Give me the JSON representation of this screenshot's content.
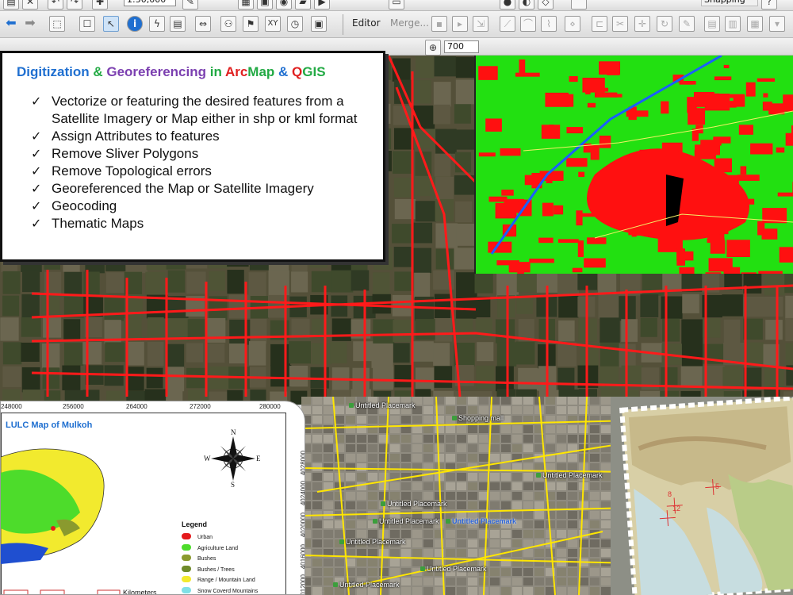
{
  "toolbar": {
    "scale_value": "1:50,000",
    "snapping_label": "Snapping",
    "editor_label": "Editor",
    "merge_label": "Merge...",
    "xy_label": "XY",
    "zoom_value": "700"
  },
  "info_box": {
    "title_parts": [
      {
        "text": "Digitization",
        "color": "#1f6fd0"
      },
      {
        "text": " & ",
        "color": "#22aa44"
      },
      {
        "text": "Georeferencing",
        "color": "#7b3fb0"
      },
      {
        "text": " in ",
        "color": "#22aa44"
      },
      {
        "text": "Arc",
        "color": "#e02020"
      },
      {
        "text": "Map",
        "color": "#22aa44"
      },
      {
        "text": " & ",
        "color": "#1f6fd0"
      },
      {
        "text": "Q",
        "color": "#e02020"
      },
      {
        "text": "GIS",
        "color": "#22aa44"
      }
    ],
    "items": [
      "Vectorize or featuring the desired features from a Satellite Imagery or Map either in shp or kml format",
      "Assign Attributes to features",
      "Remove Sliver Polygons",
      "Remove Topological errors",
      "Georeferenced the Map or Satellite Imagery",
      "Geocoding",
      "Thematic Maps"
    ]
  },
  "lulc_map": {
    "title": "LULC Map of Mulkoh",
    "x_ticks": [
      "248000",
      "256000",
      "264000",
      "272000",
      "280000"
    ],
    "y_ticks": [
      "4028000",
      "4024000",
      "4020000",
      "4016000",
      "4012000"
    ],
    "compass": {
      "n": "N",
      "s": "S",
      "e": "E",
      "w": "W"
    },
    "legend_title": "Legend",
    "legend": [
      {
        "label": "Urban",
        "color": "#e41a1c"
      },
      {
        "label": "Agriculture Land",
        "color": "#4ddc2b"
      },
      {
        "label": "Bushes",
        "color": "#8a9a2e"
      },
      {
        "label": "Bushes / Trees",
        "color": "#6f8b2a"
      },
      {
        "label": "Range / Mountain Land",
        "color": "#f2ea2e"
      },
      {
        "label": "Snow Coverd Mountains",
        "color": "#7fe0e6"
      }
    ],
    "scale_label": "Kilometers"
  },
  "city_map": {
    "placemarks": [
      {
        "label": "Untitled Placemark",
        "bold": false
      },
      {
        "label": "Shopping mall",
        "bold": false
      },
      {
        "label": "Untitled Placemark",
        "bold": false
      },
      {
        "label": "Untitled Placemark",
        "bold": false
      },
      {
        "label": "Untitled Placemark",
        "bold": false
      },
      {
        "label": "Untitled Placemark",
        "bold": true
      },
      {
        "label": "Untitled Placemark",
        "bold": false
      },
      {
        "label": "Untitled Placemark",
        "bold": false
      },
      {
        "label": "Untitled Placemark",
        "bold": false
      }
    ]
  },
  "asia_map": {
    "markers": [
      "5",
      "8",
      "12"
    ]
  }
}
